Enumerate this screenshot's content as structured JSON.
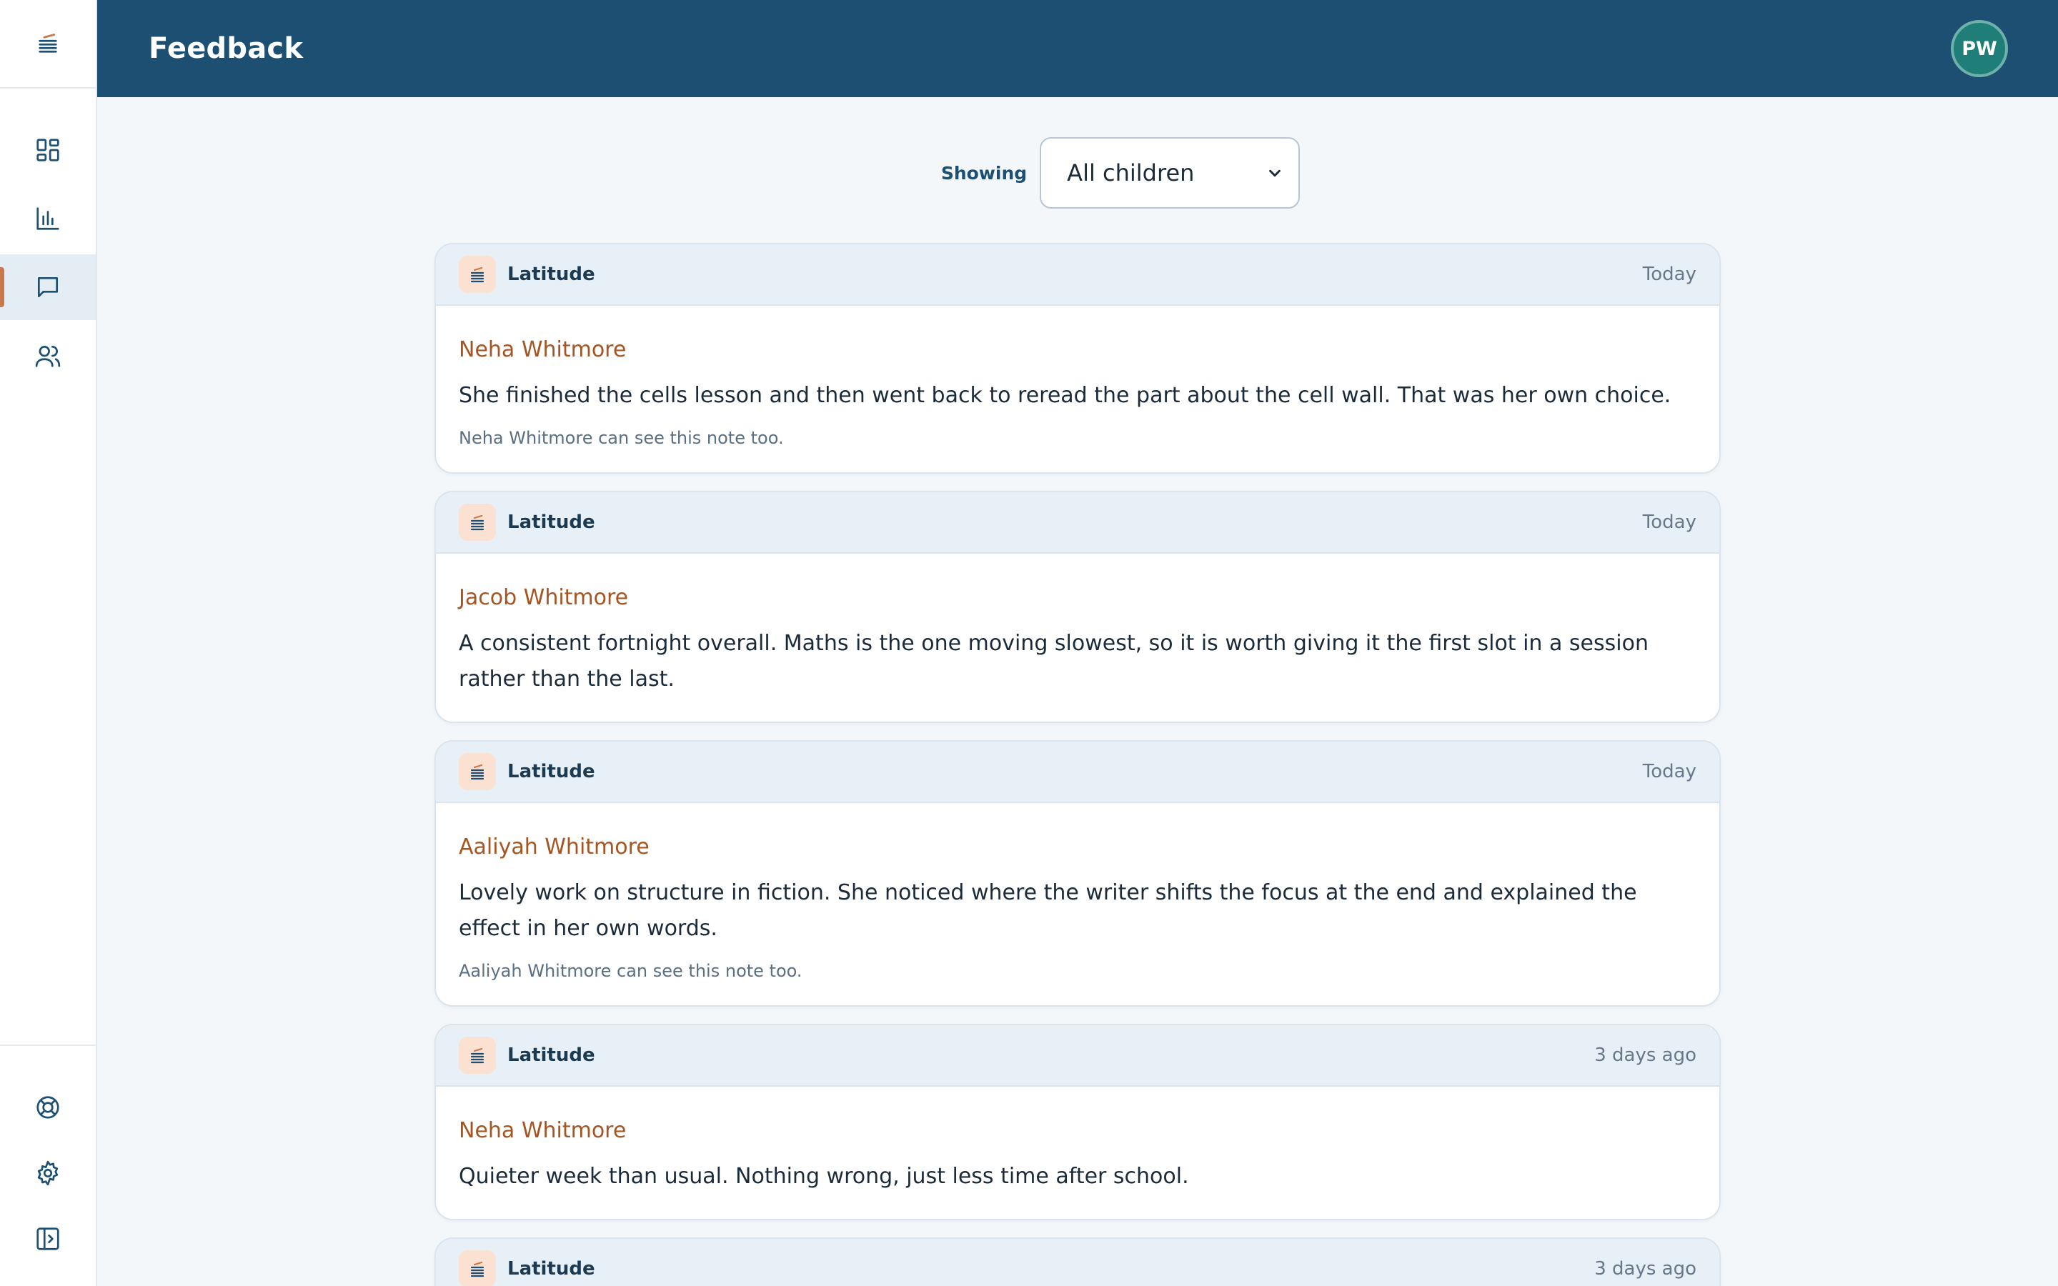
{
  "header": {
    "title": "Feedback",
    "avatar_initials": "PW"
  },
  "sidebar": {
    "logo_icon": "latitude-logo-icon",
    "nav": [
      {
        "name": "dashboard",
        "icon": "dashboard-icon",
        "active": false
      },
      {
        "name": "progress",
        "icon": "bar-chart-icon",
        "active": false
      },
      {
        "name": "feedback",
        "icon": "chat-icon",
        "active": true
      },
      {
        "name": "children",
        "icon": "users-icon",
        "active": false
      }
    ],
    "bottom": [
      {
        "name": "help",
        "icon": "lifebuoy-icon"
      },
      {
        "name": "settings",
        "icon": "gear-icon"
      },
      {
        "name": "collapse",
        "icon": "sidebar-toggle-icon"
      }
    ]
  },
  "filter": {
    "label": "Showing",
    "selected": "All children"
  },
  "feed": [
    {
      "source": "Latitude",
      "time": "Today",
      "child": "Neha Whitmore",
      "text": "She finished the cells lesson and then went back to reread the part about the cell wall. That was her own choice.",
      "visibility": "Neha Whitmore can see this note too."
    },
    {
      "source": "Latitude",
      "time": "Today",
      "child": "Jacob Whitmore",
      "text": "A consistent fortnight overall. Maths is the one moving slowest, so it is worth giving it the first slot in a session rather than the last.",
      "visibility": ""
    },
    {
      "source": "Latitude",
      "time": "Today",
      "child": "Aaliyah Whitmore",
      "text": "Lovely work on structure in fiction. She noticed where the writer shifts the focus at the end and explained the effect in her own words.",
      "visibility": "Aaliyah Whitmore can see this note too."
    },
    {
      "source": "Latitude",
      "time": "3 days ago",
      "child": "Neha Whitmore",
      "text": "Quieter week than usual. Nothing wrong, just less time after school.",
      "visibility": ""
    },
    {
      "source": "Latitude",
      "time": "3 days ago"
    }
  ],
  "colors": {
    "header": "#1c4f72",
    "accent": "#c9784c",
    "child_name": "#a55522",
    "avatar": "#1f7f78"
  }
}
